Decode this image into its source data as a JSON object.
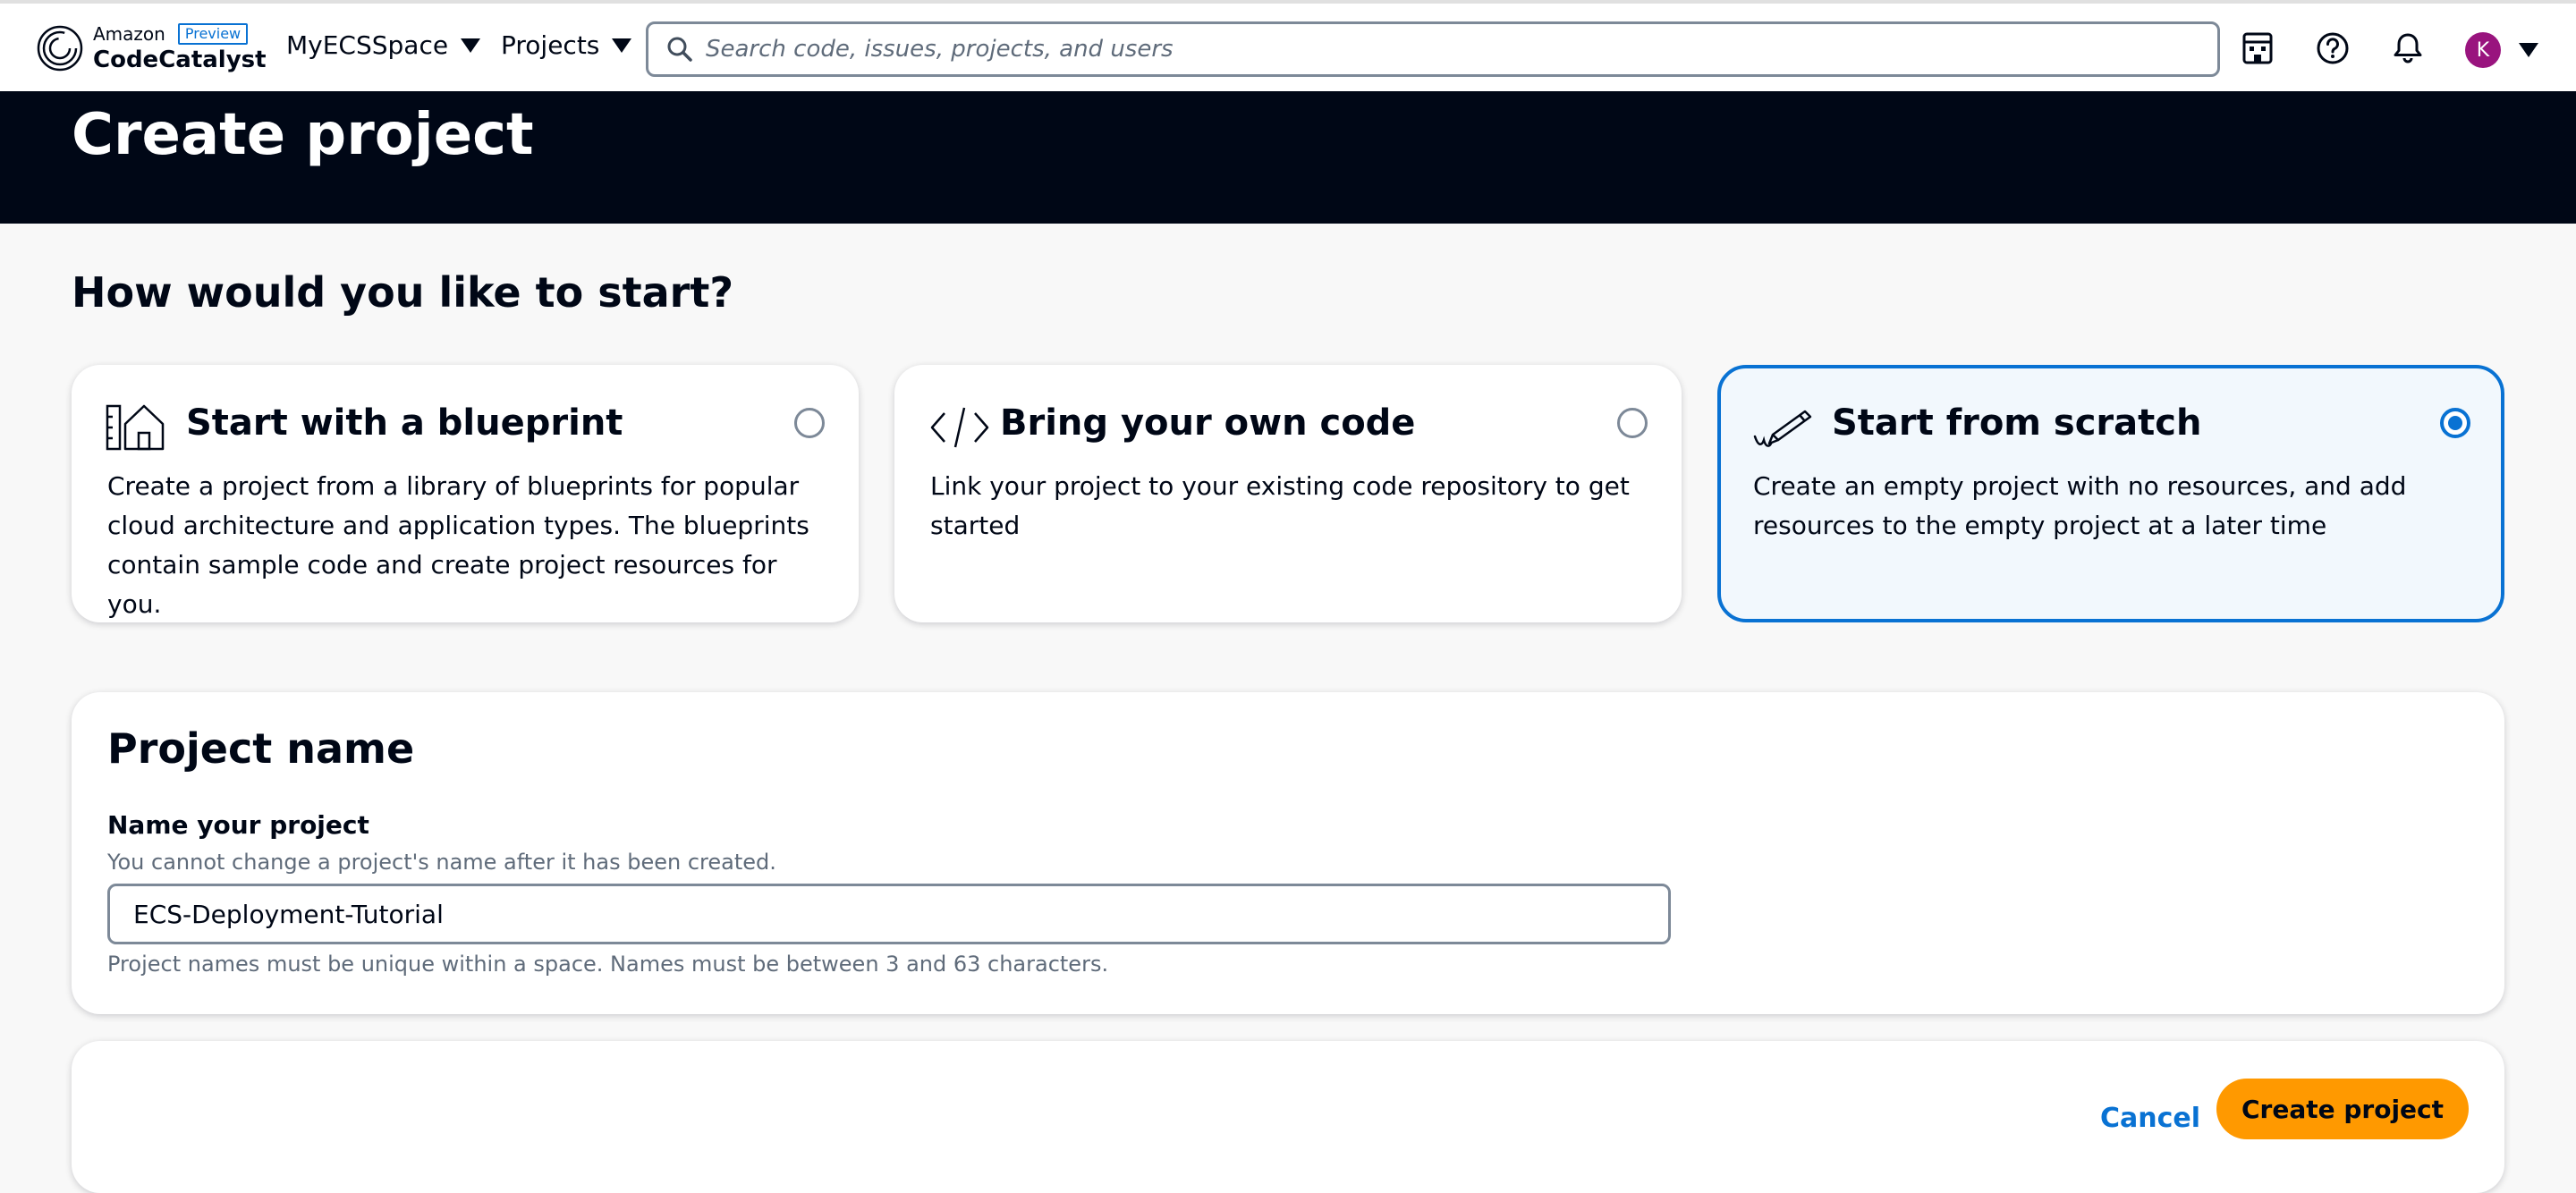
{
  "brand": {
    "line1": "Amazon",
    "badge": "Preview",
    "product": "CodeCatalyst"
  },
  "nav": {
    "space_label": "MyECSSpace",
    "projects_label": "Projects",
    "search_placeholder": "Search code, issues, projects, and users",
    "icons": [
      "building-icon",
      "help-icon",
      "bell-icon"
    ],
    "avatar_initial": "K",
    "avatar_color": "#99147e"
  },
  "header": {
    "title": "Create project"
  },
  "start": {
    "heading": "How would you like to start?",
    "options": [
      {
        "title": "Start with a blueprint",
        "description": "Create a project from a library of blueprints for popular cloud architecture and application types. The blueprints contain sample code and create project resources for you.",
        "icon": "blueprint-icon",
        "selected": false
      },
      {
        "title": "Bring your own code",
        "description": "Link your project to your existing code repository to get started",
        "icon": "code-icon",
        "selected": false
      },
      {
        "title": "Start from scratch",
        "description": "Create an empty project with no resources, and add resources to the empty project at a later time",
        "icon": "pen-icon",
        "selected": true
      }
    ]
  },
  "project_name": {
    "title": "Project name",
    "label": "Name your project",
    "hint": "You cannot change a project's name after it has been created.",
    "value": "ECS-Deployment-Tutorial",
    "constraint": "Project names must be unique within a space. Names must be between 3 and 63 characters."
  },
  "actions": {
    "cancel_label": "Cancel",
    "create_label": "Create project"
  },
  "colors": {
    "accent": "#0972d3",
    "primary_button": "#ff9900",
    "header_band": "#000716"
  }
}
